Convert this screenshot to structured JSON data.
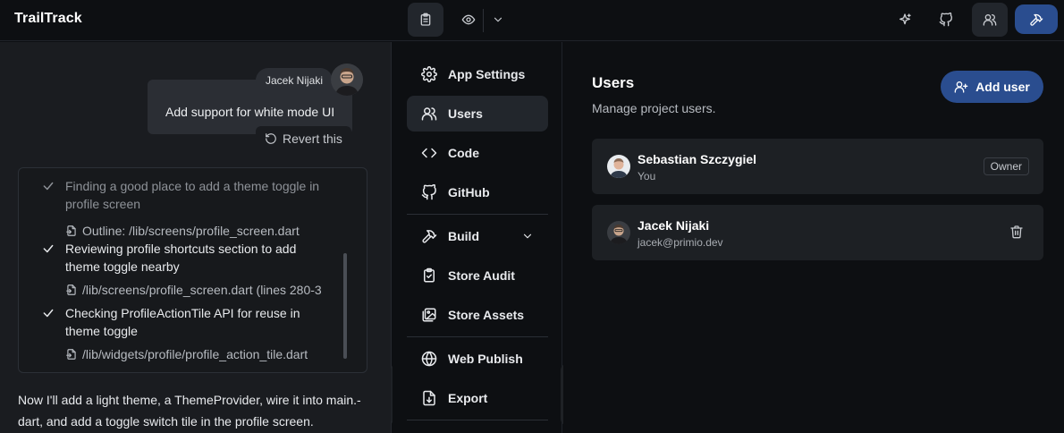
{
  "app": {
    "title": "TrailTrack"
  },
  "chat": {
    "author": "Jacek Nijaki",
    "message": "Add support for white mode UI",
    "revert_label": "Revert this",
    "steps": [
      {
        "title": "Finding a good place to add a theme toggle in profile screen",
        "file": "Outline: /lib/screens/profile_screen.dart"
      },
      {
        "title": "Reviewing profile shortcuts section to add theme toggle nearby",
        "file": "/lib/screens/profile_screen.dart (lines 280-3"
      },
      {
        "title": "Checking ProfileActionTile API for reuse in theme toggle",
        "file": "/lib/widgets/profile/profile_action_tile.dart"
      }
    ],
    "reply": "Now I'll add a light theme, a ThemeProvider, wire it into main.-dart, and add a toggle switch tile in the profile screen."
  },
  "nav": {
    "items": [
      {
        "label": "App Settings",
        "icon": "gear-icon"
      },
      {
        "label": "Users",
        "icon": "users-icon"
      },
      {
        "label": "Code",
        "icon": "code-icon"
      },
      {
        "label": "GitHub",
        "icon": "github-icon"
      },
      {
        "label": "Build",
        "icon": "hammer-icon"
      },
      {
        "label": "Store Audit",
        "icon": "clipboard-check-icon"
      },
      {
        "label": "Store Assets",
        "icon": "images-icon"
      },
      {
        "label": "Web Publish",
        "icon": "globe-icon"
      },
      {
        "label": "Export",
        "icon": "export-icon"
      }
    ],
    "active": "Users"
  },
  "users": {
    "title": "Users",
    "subtitle": "Manage project users.",
    "add_label": "Add user",
    "list": [
      {
        "name": "Sebastian Szczygiel",
        "meta": "You",
        "badge": "Owner"
      },
      {
        "name": "Jacek Nijaki",
        "meta": "jacek@primio.dev",
        "badge": ""
      }
    ]
  },
  "colors": {
    "accent": "#2a4d8f",
    "background": "#0d0f12",
    "panel": "#1a1c20",
    "card": "#1d2024"
  }
}
